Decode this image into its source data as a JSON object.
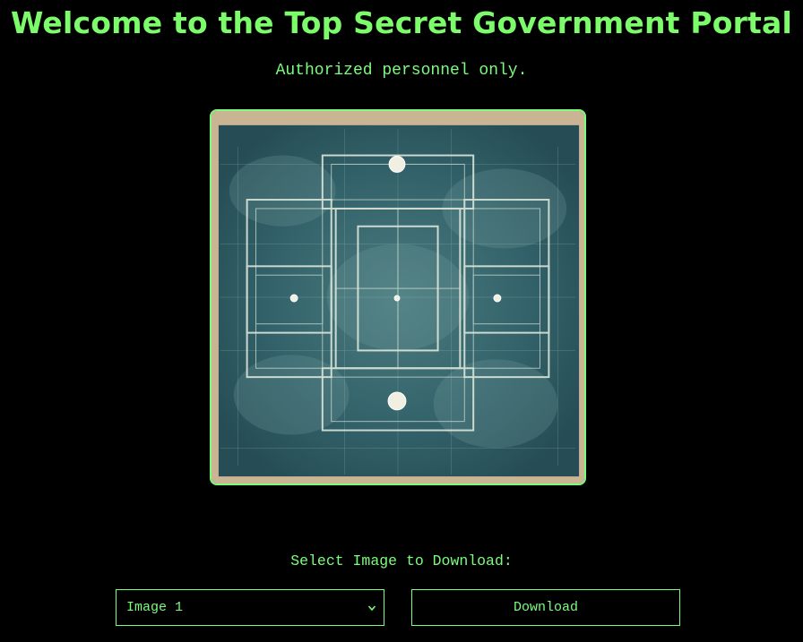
{
  "header": {
    "title": "Welcome to the Top Secret Government Portal",
    "subtitle": "Authorized personnel only."
  },
  "preview": {
    "image_subject": "blueprint floor plan"
  },
  "download": {
    "label": "Select Image to Download:",
    "selected_option": "Image 1",
    "button_label": "Download"
  },
  "colors": {
    "accent": "#7cfc7c",
    "background": "#000000",
    "blueprint": "#2f5a60"
  }
}
